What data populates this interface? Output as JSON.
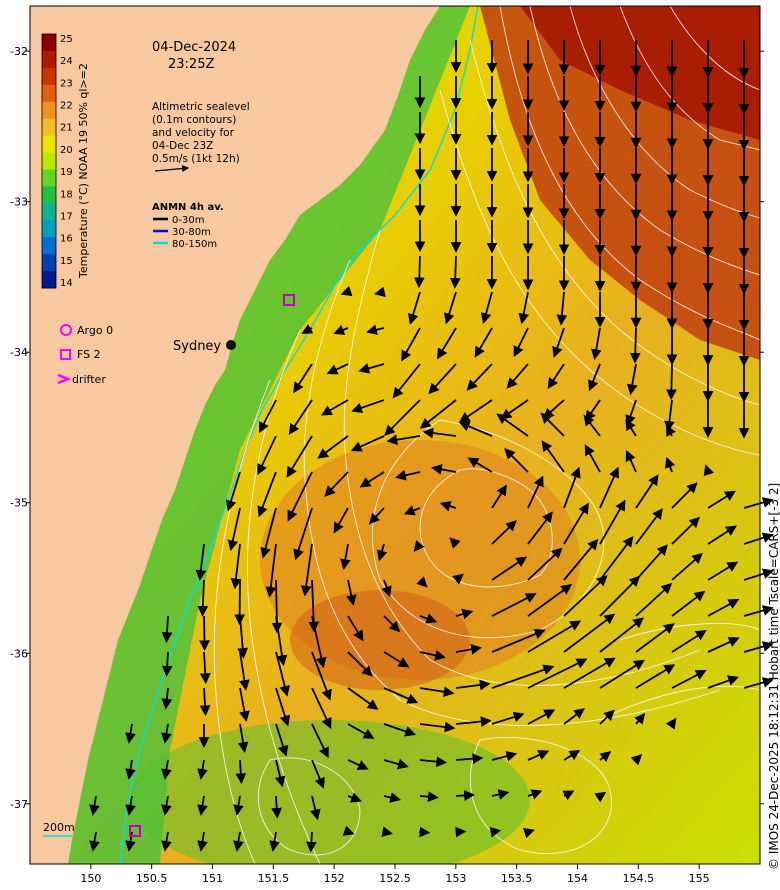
{
  "header": {
    "date": "04-Dec-2024",
    "time": "23:25Z"
  },
  "colorbar": {
    "title": "Temperature (°C) NOAA 19 50% ql>=2",
    "ticks": [
      "25",
      "24",
      "23",
      "22",
      "21",
      "20",
      "19",
      "18",
      "17",
      "16",
      "15",
      "14"
    ],
    "colors": [
      "#8b0000",
      "#b01a00",
      "#cc3300",
      "#e06010",
      "#f09020",
      "#f0c020",
      "#e8e800",
      "#b8e800",
      "#60d820",
      "#20c040",
      "#10b090",
      "#00a0c0",
      "#0070d0",
      "#0040b0",
      "#001890"
    ]
  },
  "altimetry_note": {
    "lines": [
      "Altimetric sealevel",
      "(0.1m contours)",
      "and velocity for",
      "04-Dec 23Z",
      "0.5m/s (1kt 12h)"
    ]
  },
  "anmn_legend": {
    "title": "ANMN 4h av.",
    "items": [
      {
        "label": "0-30m",
        "color": "#000000"
      },
      {
        "label": "30-80m",
        "color": "#0000ff"
      },
      {
        "label": "80-150m",
        "color": "#00e0e0"
      }
    ]
  },
  "symbol_legend": {
    "items": [
      {
        "label": "Argo 0",
        "icon": "circle-icon",
        "color": "#ff00ff"
      },
      {
        "label": "FS 2",
        "icon": "square-icon",
        "color": "#ff00ff"
      },
      {
        "label": "drifter",
        "icon": "chevron-icon",
        "color": "#ff00ff"
      }
    ]
  },
  "place_label": "Sydney",
  "depth_label": "200m",
  "credit": "© IMOS 24-Dec-2025 18:12:31 Hobart time Tscale=CARS+[-3 2]",
  "axes": {
    "x_ticks": [
      "150",
      "150.5",
      "151",
      "151.5",
      "152",
      "152.5",
      "153",
      "153.5",
      "154",
      "154.5",
      "155"
    ],
    "y_ticks": [
      "-32",
      "-33",
      "-34",
      "-35",
      "-36",
      "-37"
    ],
    "x_range": [
      149.5,
      155.5
    ],
    "y_range": [
      -37.4,
      -31.7
    ]
  },
  "colors": {
    "land": "#f8c8a0",
    "shelf_contour": "#00e0e0",
    "sealevel_contour": "#ffffff",
    "vector": "#000000",
    "marker": "#ff00ff"
  }
}
